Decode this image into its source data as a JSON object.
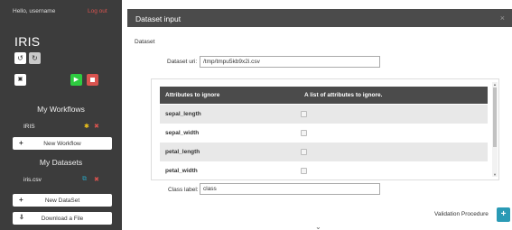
{
  "sidebar": {
    "greeting": "Hello, username",
    "logout": "Log out",
    "app_title": "IRIS",
    "buttons": {
      "undo_icon": "↺",
      "redo_icon": "↻",
      "save_icon": "💾",
      "run_icon": "▶"
    },
    "workflows_title": "My Workflows",
    "workflows": [
      {
        "name": "IRIS",
        "icon1": "✱",
        "icon2": "✖"
      }
    ],
    "new_workflow": "New Workflow",
    "datasets_title": "My Datasets",
    "datasets": [
      {
        "name": "iris.csv",
        "icon1": "⧉",
        "icon2": "✖"
      }
    ],
    "new_dataset": "New DataSet",
    "download": "Download a File",
    "plus": "+",
    "download_icon": "⇩"
  },
  "modal": {
    "title": "Dataset input",
    "close": "×",
    "subtitle": "Dataset",
    "uri_label": "Dataset uri:",
    "uri_value": "/tmp/tmpu5kb9x2i.csv",
    "table": {
      "headers": [
        "Attributes to ignore",
        "A list of attributes to ignore."
      ],
      "rows": [
        "sepal_length",
        "sepal_width",
        "petal_length",
        "petal_width"
      ]
    },
    "class_label": "Class label:",
    "class_value": "class"
  },
  "footer": {
    "validation": "Validation Procedure",
    "fab_icon": "+",
    "chevron": "⌄"
  },
  "colors": {
    "sidebar_bg": "#3c3c3c",
    "header_bg": "#4b4b4b",
    "accent_green": "#2ecc40",
    "accent_red": "#d9534f",
    "fab_blue": "#2a9ab5"
  }
}
